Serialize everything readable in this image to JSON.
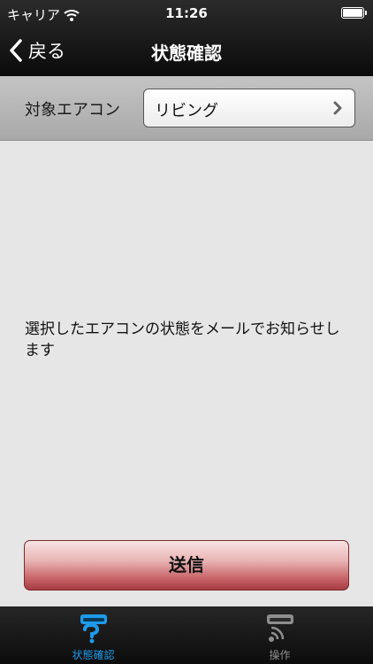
{
  "status_bar": {
    "carrier": "キャリア",
    "time": "11:26"
  },
  "nav": {
    "back_label": "戻る",
    "title": "状態確認"
  },
  "target": {
    "label": "対象エアコン",
    "value": "リビング"
  },
  "message": "選択したエアコンの状態をメールでお知らせします",
  "send_button": "送信",
  "tabs": [
    {
      "label": "状態確認",
      "icon": "status-check-icon",
      "active": true,
      "color": "#1e9bea"
    },
    {
      "label": "操作",
      "icon": "remote-operation-icon",
      "active": false,
      "color": "#8e8e8e"
    }
  ],
  "colors": {
    "send_button": "#c9686c",
    "active_tab": "#1e9bea"
  }
}
